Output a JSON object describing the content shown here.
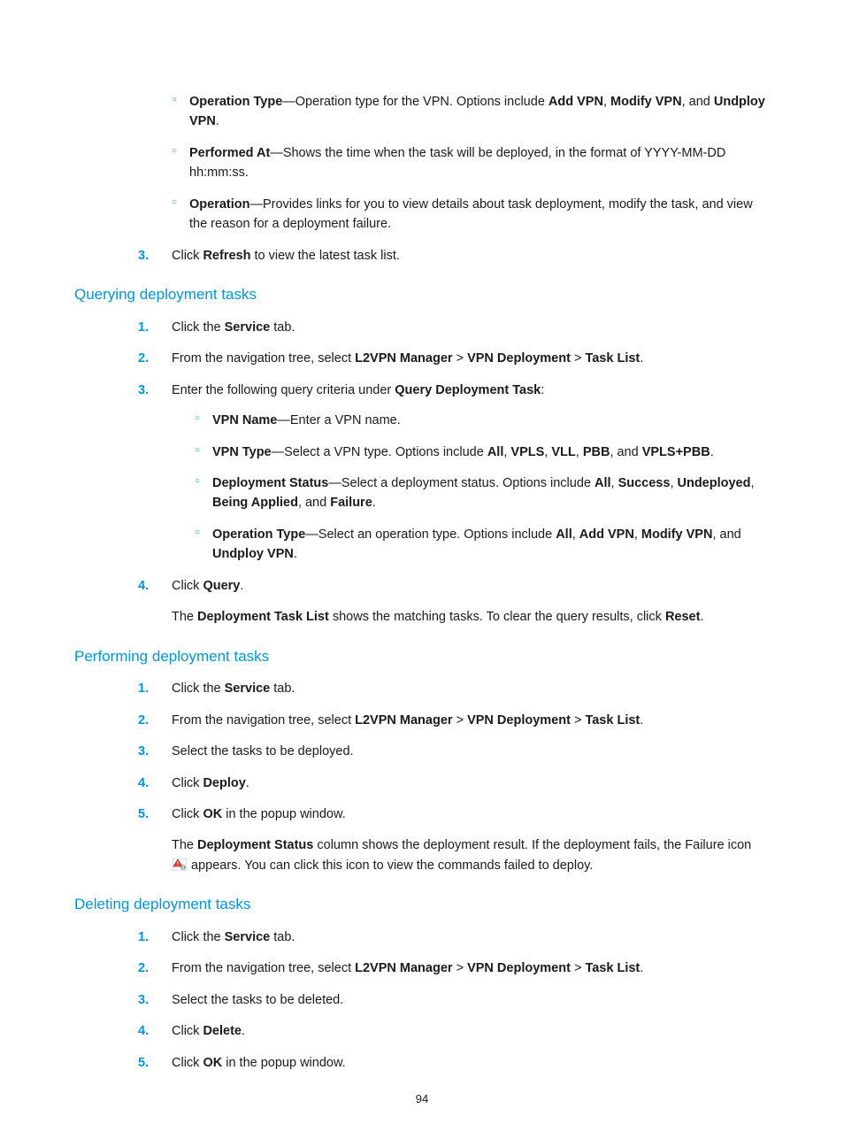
{
  "pageNumber": "94",
  "topBullets": {
    "b1_bold": "Operation Type",
    "b1_mid": "—Operation type for the VPN. Options include ",
    "b1_o1": "Add VPN",
    "b1_sep1": ", ",
    "b1_o2": "Modify VPN",
    "b1_sep2": ", and ",
    "b1_o3": "Undploy VPN",
    "b1_end": ".",
    "b2_bold": "Performed At",
    "b2_rest": "—Shows the time when the task will be deployed, in the format of YYYY-MM-DD hh:mm:ss.",
    "b3_bold": "Operation",
    "b3_rest": "—Provides links for you to view details about task deployment, modify the task, and view the reason for a deployment failure."
  },
  "topStep3": {
    "pre": "Click ",
    "bold": "Refresh",
    "post": " to view the latest task list."
  },
  "sec1_title": "Querying deployment tasks",
  "s1_1": {
    "pre": "Click the ",
    "bold": "Service",
    "post": " tab."
  },
  "s1_2": {
    "pre": "From the navigation tree, select ",
    "b1": "L2VPN Manager",
    "s1": " > ",
    "b2": "VPN Deployment",
    "s2": " > ",
    "b3": "Task List",
    "post": "."
  },
  "s1_3": {
    "pre": "Enter the following query criteria under ",
    "bold": "Query Deployment Task",
    "post": ":"
  },
  "s1_b": {
    "a_bold": "VPN Name",
    "a_rest": "—Enter a VPN name.",
    "b_bold": "VPN Type",
    "b_pre": "—Select a VPN type. Options include ",
    "b_o1": "All",
    "b_c1": ", ",
    "b_o2": "VPLS",
    "b_c2": ", ",
    "b_o3": "VLL",
    "b_c3": ", ",
    "b_o4": "PBB",
    "b_c4": ", and ",
    "b_o5": "VPLS+PBB",
    "b_end": ".",
    "c_bold": "Deployment Status",
    "c_pre": "—Select a deployment status. Options include ",
    "c_o1": "All",
    "c_c1": ", ",
    "c_o2": "Success",
    "c_c2": ", ",
    "c_o3": "Undeployed",
    "c_c3": ", ",
    "c_o4": "Being Applied",
    "c_c4": ", and ",
    "c_o5": "Failure",
    "c_end": ".",
    "d_bold": "Operation Type",
    "d_pre": "—Select an operation type. Options include ",
    "d_o1": "All",
    "d_c1": ", ",
    "d_o2": "Add VPN",
    "d_c2": ", ",
    "d_o3": "Modify VPN",
    "d_c3": ", and ",
    "d_o4": "Undploy VPN",
    "d_end": "."
  },
  "s1_4": {
    "pre": "Click ",
    "bold": "Query",
    "post": "."
  },
  "s1_para": {
    "t1": "The ",
    "b1": "Deployment Task List",
    "t2": " shows the matching tasks. To clear the query results, click ",
    "b2": "Reset",
    "t3": "."
  },
  "sec2_title": "Performing deployment tasks",
  "s2_1": {
    "pre": "Click the ",
    "bold": "Service",
    "post": " tab."
  },
  "s2_2": {
    "pre": "From the navigation tree, select ",
    "b1": "L2VPN Manager",
    "s1": " > ",
    "b2": "VPN Deployment",
    "s2": " > ",
    "b3": "Task List",
    "post": "."
  },
  "s2_3": "Select the tasks to be deployed.",
  "s2_4": {
    "pre": "Click ",
    "bold": "Deploy",
    "post": "."
  },
  "s2_5": {
    "pre": "Click ",
    "bold": "OK",
    "post": " in the popup window."
  },
  "s2_para": {
    "t1": "The ",
    "b1": "Deployment Status",
    "t2": " column shows the deployment result. If the deployment fails, the Failure icon ",
    "t3": " appears. You can click this icon to view the commands failed to deploy."
  },
  "sec3_title": "Deleting deployment tasks",
  "s3_1": {
    "pre": "Click the ",
    "bold": "Service",
    "post": " tab."
  },
  "s3_2": {
    "pre": "From the navigation tree, select ",
    "b1": "L2VPN Manager",
    "s1": " > ",
    "b2": "VPN Deployment",
    "s2": " > ",
    "b3": "Task List",
    "post": "."
  },
  "s3_3": "Select the tasks to be deleted.",
  "s3_4": {
    "pre": "Click ",
    "bold": "Delete",
    "post": "."
  },
  "s3_5": {
    "pre": "Click ",
    "bold": "OK",
    "post": " in the popup window."
  },
  "markers": {
    "m1": "1.",
    "m2": "2.",
    "m3": "3.",
    "m4": "4.",
    "m5": "5."
  }
}
